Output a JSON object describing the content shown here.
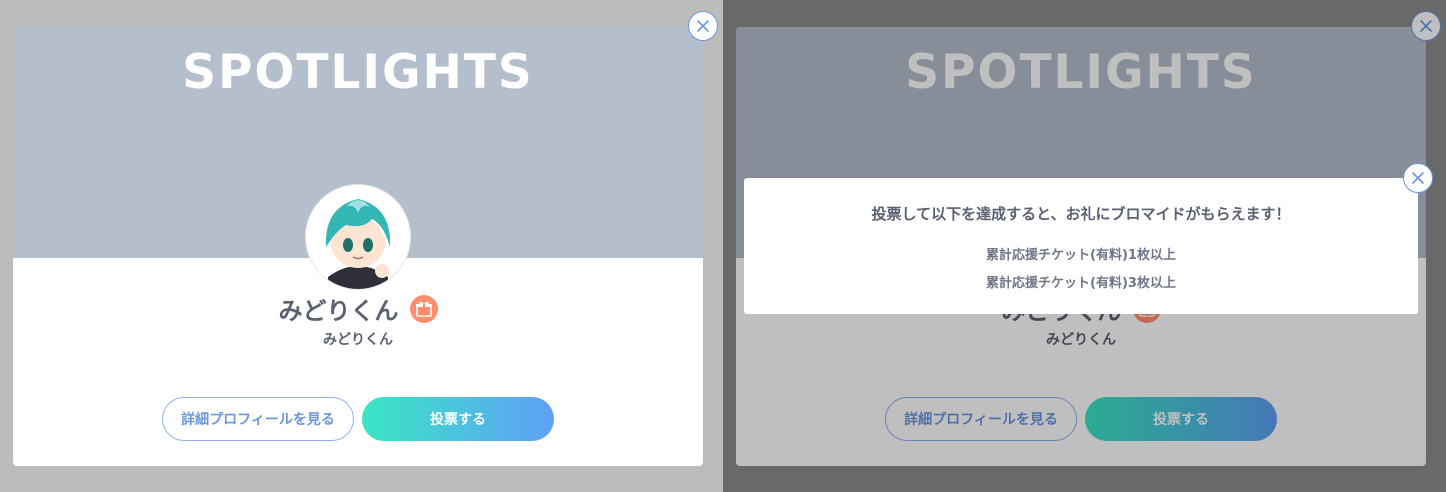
{
  "banner_title": "SPOTLIGHTS",
  "user": {
    "name": "みどりくん",
    "sub_name": "みどりくん"
  },
  "buttons": {
    "profile": "詳細プロフィールを見る",
    "vote": "投票する"
  },
  "popup": {
    "title": "投票して以下を達成すると、お礼にブロマイドがもらえます！",
    "conditions": [
      "累計応援チケット(有料)1枚以上",
      "累計応援チケット(有料)3枚以上"
    ]
  },
  "icons": {
    "close": "close-icon",
    "gift": "gift-icon",
    "avatar": "avatar-illustration"
  },
  "colors": {
    "banner": "#b4becd",
    "accent_blue": "#6b97e0",
    "vote_gradient_start": "#39e6c4",
    "vote_gradient_end": "#5fa0f7",
    "gift": "#ff8d6e",
    "text": "#5a6170"
  }
}
